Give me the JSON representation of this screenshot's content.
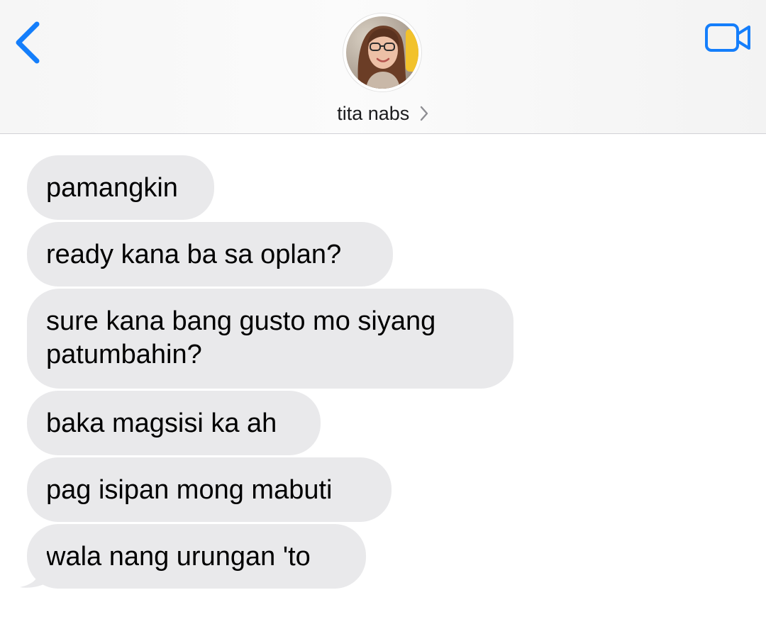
{
  "header": {
    "contact_name": "tita nabs",
    "back_icon": "chevron-left-icon",
    "video_icon": "video-camera-icon",
    "chevron_icon": "chevron-right-icon",
    "accent_color": "#147efb"
  },
  "messages": [
    {
      "text": "pamangkin"
    },
    {
      "text": "ready kana ba sa oplan?"
    },
    {
      "text": "sure kana bang gusto mo siyang patumbahin?"
    },
    {
      "text": "baka magsisi ka ah"
    },
    {
      "text": "pag isipan mong mabuti"
    },
    {
      "text": "wala nang urungan 'to"
    }
  ],
  "colors": {
    "incoming_bubble": "#e9e9eb",
    "background": "#ffffff"
  }
}
